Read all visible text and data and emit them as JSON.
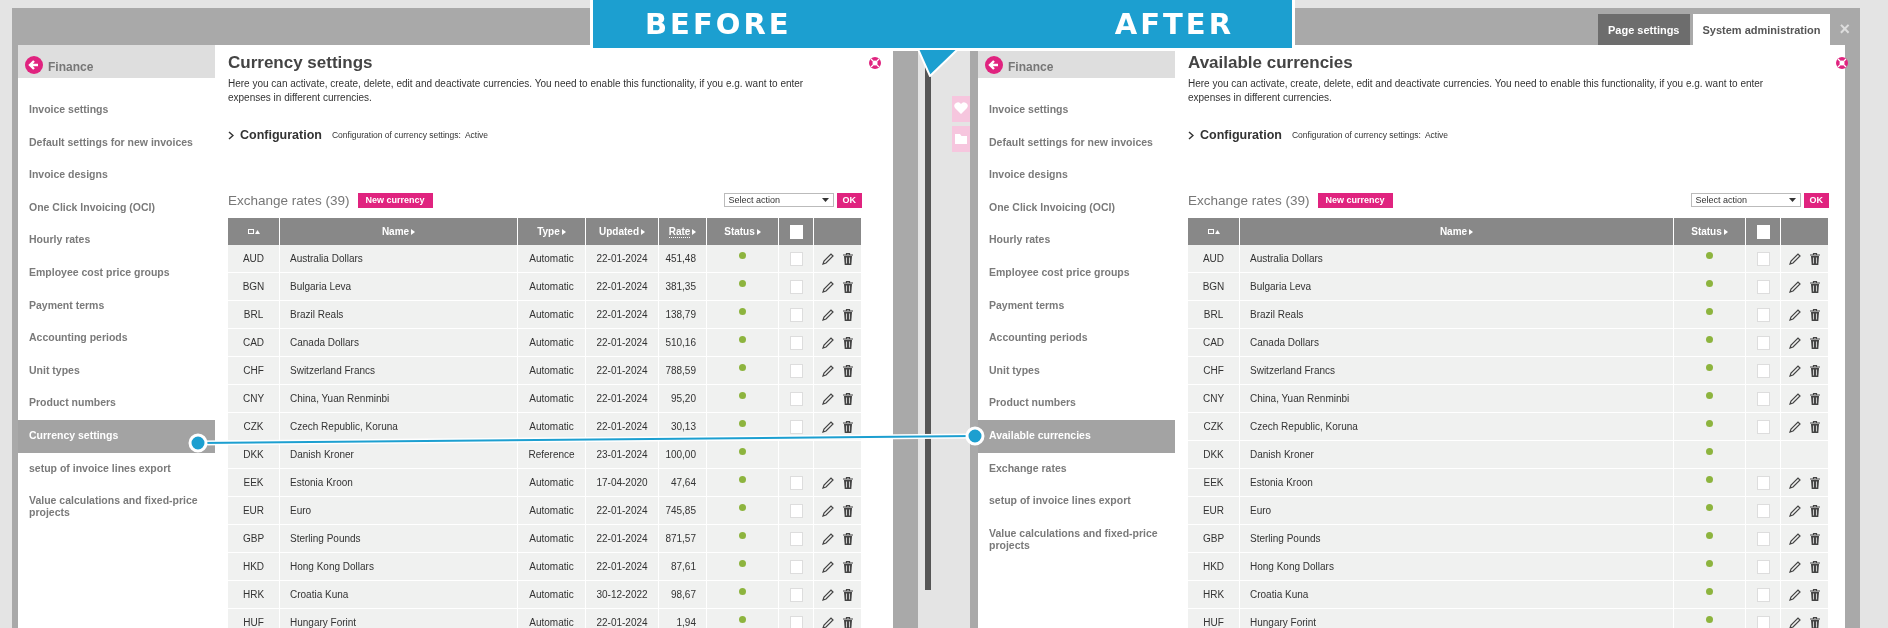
{
  "banner": {
    "before": "BEFORE",
    "after": "AFTER"
  },
  "panels": [
    {
      "sidebar": {
        "header": "Finance",
        "items": [
          {
            "label": "Invoice settings",
            "selected": false
          },
          {
            "label": "Default settings for new invoices",
            "selected": false
          },
          {
            "label": "Invoice designs",
            "selected": false
          },
          {
            "label": "One Click Invoicing (OCI)",
            "selected": false
          },
          {
            "label": "Hourly rates",
            "selected": false
          },
          {
            "label": "Employee cost price groups",
            "selected": false
          },
          {
            "label": "Payment terms",
            "selected": false
          },
          {
            "label": "Accounting periods",
            "selected": false
          },
          {
            "label": "Unit types",
            "selected": false
          },
          {
            "label": "Product numbers",
            "selected": false
          },
          {
            "label": "Currency settings",
            "selected": true
          },
          {
            "label": "setup of invoice lines export",
            "selected": false
          },
          {
            "label": "Value calculations and fixed-price projects",
            "selected": false
          }
        ]
      },
      "content": {
        "title": "Currency settings",
        "description": "Here you can activate, create, delete, edit and deactivate currencies. You need to enable this functionality, if you e.g. want to enter expenses in different currencies.",
        "configuration": {
          "label": "Configuration",
          "setting_label": "Configuration of currency settings:",
          "setting_value": "Active"
        },
        "section_title": "Exchange rates (39)",
        "new_button": "New currency",
        "action_select": "Select action",
        "ok_button": "OK",
        "table": {
          "columns": [
            {
              "kind": "code"
            },
            {
              "kind": "name",
              "label": "Name"
            },
            {
              "kind": "type",
              "label": "Type"
            },
            {
              "kind": "date",
              "label": "Updated"
            },
            {
              "kind": "number",
              "label": "Rate"
            },
            {
              "kind": "status",
              "label": "Status"
            },
            {
              "kind": "select",
              "checked": false
            },
            {
              "kind": "actions"
            }
          ],
          "rows": [
            {
              "cells": [
                "AUD",
                "Australia Dollars",
                "Automatic",
                "22-01-2024",
                "451,48"
              ],
              "active": true,
              "editable": true,
              "checked": false
            },
            {
              "cells": [
                "BGN",
                "Bulgaria Leva",
                "Automatic",
                "22-01-2024",
                "381,35"
              ],
              "active": true,
              "editable": true,
              "checked": false
            },
            {
              "cells": [
                "BRL",
                "Brazil Reals",
                "Automatic",
                "22-01-2024",
                "138,79"
              ],
              "active": true,
              "editable": true,
              "checked": false
            },
            {
              "cells": [
                "CAD",
                "Canada Dollars",
                "Automatic",
                "22-01-2024",
                "510,16"
              ],
              "active": true,
              "editable": true,
              "checked": false
            },
            {
              "cells": [
                "CHF",
                "Switzerland Francs",
                "Automatic",
                "22-01-2024",
                "788,59"
              ],
              "active": true,
              "editable": true,
              "checked": false
            },
            {
              "cells": [
                "CNY",
                "China, Yuan Renminbi",
                "Automatic",
                "22-01-2024",
                "95,20"
              ],
              "active": true,
              "editable": true,
              "checked": false
            },
            {
              "cells": [
                "CZK",
                "Czech Republic, Koruna",
                "Automatic",
                "22-01-2024",
                "30,13"
              ],
              "active": true,
              "editable": true,
              "checked": false
            },
            {
              "cells": [
                "DKK",
                "Danish Kroner",
                "Reference",
                "23-01-2024",
                "100,00"
              ],
              "active": true,
              "editable": false
            },
            {
              "cells": [
                "EEK",
                "Estonia Kroon",
                "Automatic",
                "17-04-2020",
                "47,64"
              ],
              "active": true,
              "editable": true,
              "checked": false
            },
            {
              "cells": [
                "EUR",
                "Euro",
                "Automatic",
                "22-01-2024",
                "745,85"
              ],
              "active": true,
              "editable": true,
              "checked": false
            },
            {
              "cells": [
                "GBP",
                "Sterling Pounds",
                "Automatic",
                "22-01-2024",
                "871,57"
              ],
              "active": true,
              "editable": true,
              "checked": false
            },
            {
              "cells": [
                "HKD",
                "Hong Kong Dollars",
                "Automatic",
                "22-01-2024",
                "87,61"
              ],
              "active": true,
              "editable": true,
              "checked": false
            },
            {
              "cells": [
                "HRK",
                "Croatia Kuna",
                "Automatic",
                "30-12-2022",
                "98,67"
              ],
              "active": true,
              "editable": true,
              "checked": false
            },
            {
              "cells": [
                "HUF",
                "Hungary Forint",
                "Automatic",
                "22-01-2024",
                "1,94"
              ],
              "active": true,
              "editable": true,
              "checked": false
            }
          ]
        }
      }
    },
    {
      "tabs": [
        {
          "label": "Page settings",
          "selected": false
        },
        {
          "label": "System administration",
          "selected": true
        }
      ],
      "close_button": "×",
      "sidebar": {
        "header": "Finance",
        "items": [
          {
            "label": "Invoice settings",
            "selected": false
          },
          {
            "label": "Default settings for new invoices",
            "selected": false
          },
          {
            "label": "Invoice designs",
            "selected": false
          },
          {
            "label": "One Click Invoicing (OCI)",
            "selected": false
          },
          {
            "label": "Hourly rates",
            "selected": false
          },
          {
            "label": "Employee cost price groups",
            "selected": false
          },
          {
            "label": "Payment terms",
            "selected": false
          },
          {
            "label": "Accounting periods",
            "selected": false
          },
          {
            "label": "Unit types",
            "selected": false
          },
          {
            "label": "Product numbers",
            "selected": false
          },
          {
            "label": "Available currencies",
            "selected": true
          },
          {
            "label": "Exchange rates",
            "selected": false
          },
          {
            "label": "setup of invoice lines export",
            "selected": false
          },
          {
            "label": "Value calculations and fixed-price projects",
            "selected": false
          }
        ]
      },
      "content": {
        "title": "Available currencies",
        "description": "Here you can activate, create, delete, edit and deactivate currencies. You need to enable this functionality, if you e.g. want to enter expenses in different currencies.",
        "configuration": {
          "label": "Configuration",
          "setting_label": "Configuration of currency settings:",
          "setting_value": "Active"
        },
        "section_title": "Exchange rates (39)",
        "new_button": "New currency",
        "action_select": "Select action",
        "ok_button": "OK",
        "table": {
          "columns": [
            {
              "kind": "code"
            },
            {
              "kind": "name",
              "label": "Name"
            },
            {
              "kind": "status",
              "label": "Status"
            },
            {
              "kind": "select",
              "checked": false
            },
            {
              "kind": "actions"
            }
          ],
          "rows": [
            {
              "cells": [
                "AUD",
                "Australia Dollars"
              ],
              "active": true,
              "editable": true,
              "checked": false
            },
            {
              "cells": [
                "BGN",
                "Bulgaria Leva"
              ],
              "active": true,
              "editable": true,
              "checked": false
            },
            {
              "cells": [
                "BRL",
                "Brazil Reals"
              ],
              "active": true,
              "editable": true,
              "checked": false
            },
            {
              "cells": [
                "CAD",
                "Canada Dollars"
              ],
              "active": true,
              "editable": true,
              "checked": false
            },
            {
              "cells": [
                "CHF",
                "Switzerland Francs"
              ],
              "active": true,
              "editable": true,
              "checked": false
            },
            {
              "cells": [
                "CNY",
                "China, Yuan Renminbi"
              ],
              "active": true,
              "editable": true,
              "checked": false
            },
            {
              "cells": [
                "CZK",
                "Czech Republic, Koruna"
              ],
              "active": true,
              "editable": true,
              "checked": false
            },
            {
              "cells": [
                "DKK",
                "Danish Kroner"
              ],
              "active": true,
              "editable": false
            },
            {
              "cells": [
                "EEK",
                "Estonia Kroon"
              ],
              "active": true,
              "editable": true,
              "checked": false
            },
            {
              "cells": [
                "EUR",
                "Euro"
              ],
              "active": true,
              "editable": true,
              "checked": false
            },
            {
              "cells": [
                "GBP",
                "Sterling Pounds"
              ],
              "active": true,
              "editable": true,
              "checked": false
            },
            {
              "cells": [
                "HKD",
                "Hong Kong Dollars"
              ],
              "active": true,
              "editable": true,
              "checked": false
            },
            {
              "cells": [
                "HRK",
                "Croatia Kuna"
              ],
              "active": true,
              "editable": true,
              "checked": false
            },
            {
              "cells": [
                "HUF",
                "Hungary Forint"
              ],
              "active": true,
              "editable": true,
              "checked": false
            }
          ]
        }
      }
    }
  ]
}
